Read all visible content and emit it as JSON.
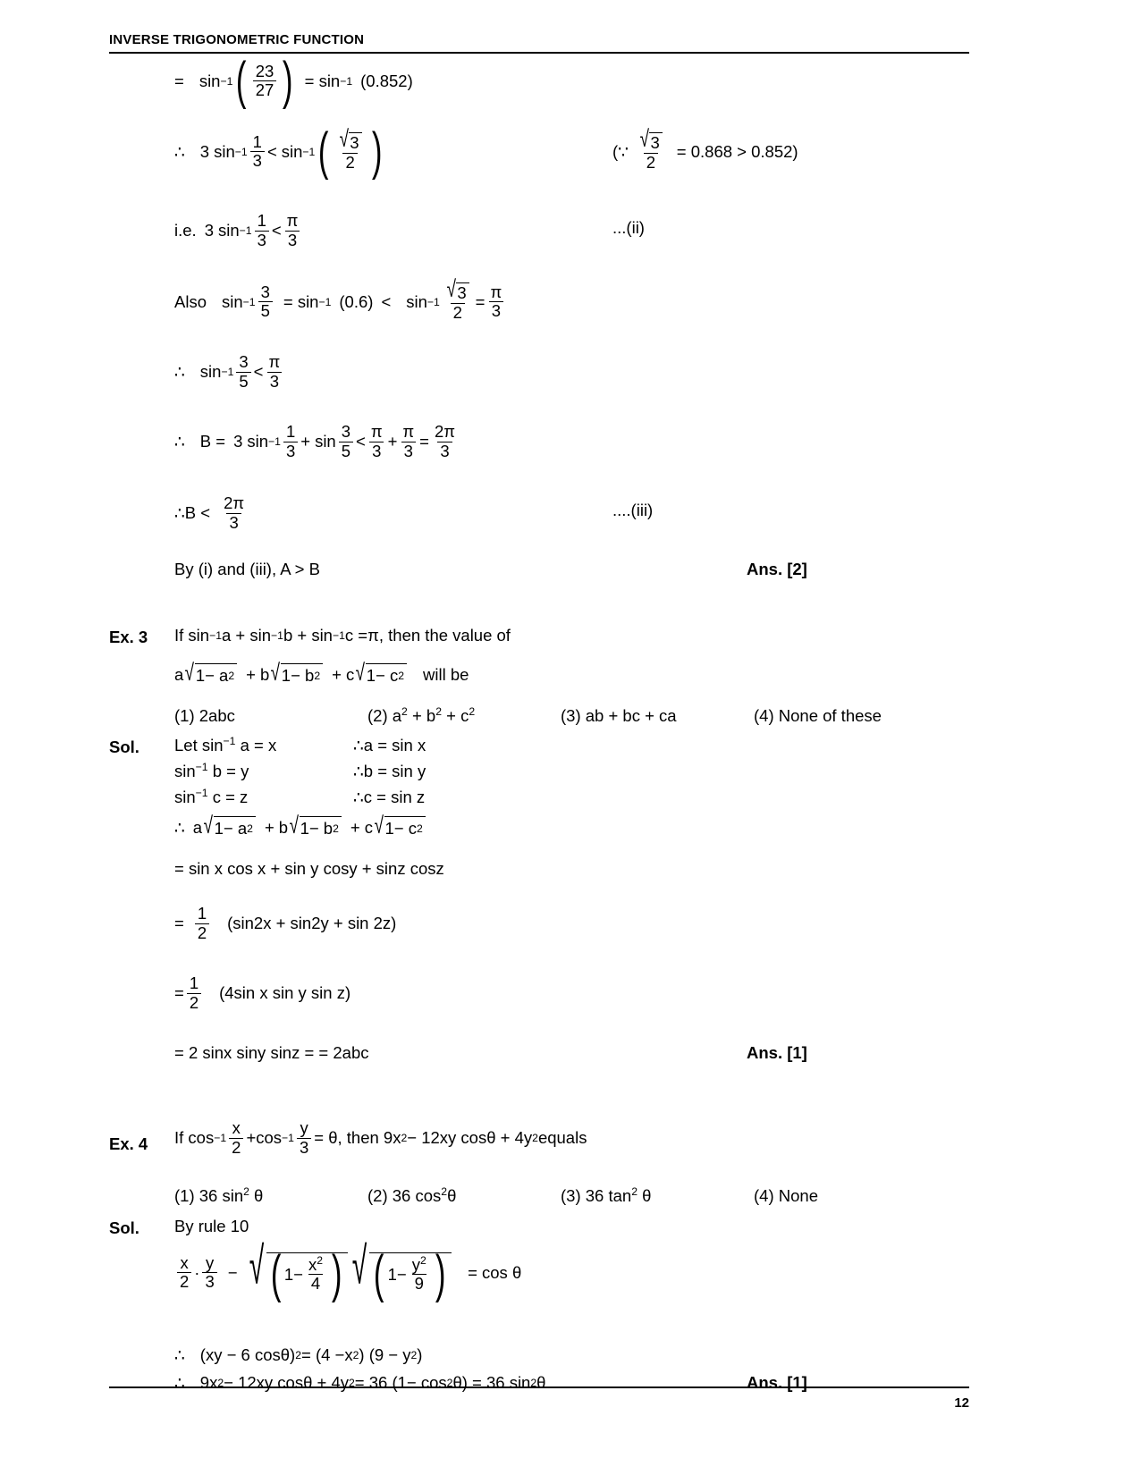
{
  "header": {
    "title": "INVERSE TRIGONOMETRIC FUNCTION"
  },
  "footer": {
    "page_number": "12"
  },
  "symbols": {
    "therefore": "∴",
    "because": "∵",
    "pi": "π",
    "theta": "θ",
    "minus": "−",
    "lt": "<",
    "gt": ">",
    "eq": "=",
    "plus": "+",
    "dot": "·",
    "radical": "√",
    "paren_open": "(",
    "paren_close": ")"
  },
  "lines": {
    "l1": {
      "eq_sign": "=",
      "sin_inv": "sin",
      "inv": "−1",
      "frac_num": "23",
      "frac_den": "27",
      "eq2": "= sin",
      "value": "(0.852)"
    },
    "l2": {
      "coef": "3",
      "fn": "sin",
      "inv": "−1",
      "num1": "1",
      "den1": "3",
      "rel": "<",
      "fn2": "sin",
      "inv2": "−1",
      "rad_num": "3",
      "den2": "2",
      "note_open": "(",
      "note_rad": "3",
      "note_den": "2",
      "note_text": "= 0.868 > 0.852)"
    },
    "l3": {
      "prefix": "i.e.",
      "coef": "3",
      "fn": "sin",
      "inv": "−1",
      "num1": "1",
      "den1": "3",
      "rel": "<",
      "pi_num": "π",
      "pi_den": "3",
      "tag": "...(ii)"
    },
    "l4": {
      "prefix": "Also",
      "fn": "sin",
      "inv": "−1",
      "num1": "3",
      "den1": "5",
      "eq": "= sin",
      "inv2": "−1",
      "value": "(0.6)",
      "rel": "<",
      "fn3": "sin",
      "inv3": "−1",
      "rad_num": "3",
      "den3": "2",
      "eq2": "=",
      "pi_num": "π",
      "pi_den": "3"
    },
    "l5": {
      "fn": "sin",
      "inv": "−1",
      "num": "3",
      "den": "5",
      "rel": "<",
      "pi_num": "π",
      "pi_den": "3"
    },
    "l6": {
      "lhs": "B  =",
      "coef": "3",
      "fn": "sin",
      "inv": "−1",
      "num1": "1",
      "den1": "3",
      "plus": "+",
      "fn2": "sin",
      "num2": "3",
      "den2": "5",
      "rel": "<",
      "pi_num": "π",
      "pi_den": "3",
      "plus2": "+",
      "pi_num2": "π",
      "pi_den2": "3",
      "eq": "=",
      "res_num": "2π",
      "res_den": "3"
    },
    "l7": {
      "lhs": "B  <",
      "num": "2π",
      "den": "3",
      "tag": "....(iii)"
    },
    "l8": {
      "text": "By (i) and (iii), A > B",
      "ans": "Ans. [2]"
    }
  },
  "ex3": {
    "label": "Ex. 3",
    "stem_pre": "If sin",
    "inv": "−1",
    "stem": " a + sin",
    "stem2": "b + sin",
    "stem3": "c = ",
    "theta_end": "π, then the value of",
    "expr": {
      "a": "a",
      "r1": "1− a",
      "sup1": "2",
      "plus1": "+",
      "b": "b",
      "r2": "1− b",
      "sup2": "2",
      "plus2": "+",
      "c": "c",
      "r3": "1− c",
      "sup3": "2",
      "tail": "will be"
    },
    "options": [
      "(1) 2abc",
      "(2) a² + b² + c²",
      "(3) ab + bc + ca",
      "(4) None of these"
    ],
    "options_rich": {
      "o1": "(1) 2abc",
      "o2_pre": "(2) a",
      "o2_mid": " + b",
      "o2_mid2": " + c",
      "o2_sup": "2",
      "o3": "(3) ab + bc + ca",
      "o4": "(4) None of these"
    },
    "sol_label": "Sol.",
    "steps": [
      {
        "left": "Let sin⁻¹ a = x",
        "right": "∴a = sin x"
      },
      {
        "left": "sin⁻¹ b = y",
        "right": "∴b = sin y"
      },
      {
        "left": "sin⁻¹ c = z",
        "right": "∴c = sin z"
      }
    ],
    "steps_rich": [
      {
        "pre": "Let sin",
        "inv": "−1",
        "post": " a = x",
        "right_sym": "∴",
        "right": "a = sin x"
      },
      {
        "pre": "sin",
        "inv": "−1",
        "post": " b = y",
        "right_sym": "∴",
        "right": "b = sin y"
      },
      {
        "pre": "sin",
        "inv": "−1",
        "post": " c = z",
        "right_sym": "∴",
        "right": "c = sin z"
      }
    ],
    "line_expr2_tail": "",
    "line_sincos": "= sin x cos x + sin y cosy + sinz cosz",
    "half1": {
      "eq": "=",
      "num": "1",
      "den": "2",
      "text": "(sin2x + sin2y + sin 2z)"
    },
    "half2": {
      "eq": "=",
      "num": "1",
      "den": "2",
      "text": "(4sin x sin y sin z)"
    },
    "final": "= 2 sinx siny sinz = = 2abc",
    "ans": "Ans. [1]"
  },
  "ex4": {
    "label": "Ex. 4",
    "stem_pre": "If cos",
    "inv": "−1",
    "x_num": "x",
    "x_den": "2",
    "plus": "+",
    "fn2": "cos",
    "inv2": "−1",
    "y_num": "y",
    "y_den": "3",
    "eq_theta": "= θ",
    "stem_post": ", then 9x",
    "sup2": "2",
    "stem_post2": " − 12xy cosθ + 4y",
    "stem_post3": " equals",
    "options_rich": {
      "o1_pre": "(1) 36 sin",
      "o1_sup": "2",
      "o1_post": " θ",
      "o2_pre": "(2) 36 cos",
      "o2_sup": "2",
      "o2_post": "θ",
      "o3_pre": "(3) 36 tan",
      "o3_sup": "2",
      "o3_post": " θ",
      "o4": "(4) None"
    },
    "sol_label": "Sol.",
    "rule": "By rule 10",
    "big_eq": {
      "x_num": "x",
      "x_den": "2",
      "dot": "·",
      "y_num": "y",
      "y_den": "3",
      "minus": "−",
      "one1": "1−",
      "xx_num": "x",
      "xx_sup": "2",
      "xx_den": "4",
      "one2": "1−",
      "yy_num": "y",
      "yy_sup": "2",
      "yy_den": "9",
      "rhs": "= cos θ"
    },
    "concl1_sym": "∴",
    "concl1": "(xy − 6 cosθ)² = (4 −x²) (9 − y²)",
    "concl1_rich": {
      "p1": "(xy − 6 cosθ)",
      "s1": "2",
      "p2": " = (4 −x",
      "s2": "2",
      "p3": ") (9 − y",
      "s3": "2",
      "p4": ")"
    },
    "concl2_sym": "∴",
    "concl2_rich": {
      "p1": "9x",
      "s1": "2",
      "p2": " − 12xy cosθ + 4y",
      "s2": "2",
      "p3": " = 36 (1− cos",
      "s3": "2",
      "p4": "θ) = 36 sin",
      "s4": "2",
      "p5": " θ"
    },
    "ans": "Ans. [1]"
  }
}
